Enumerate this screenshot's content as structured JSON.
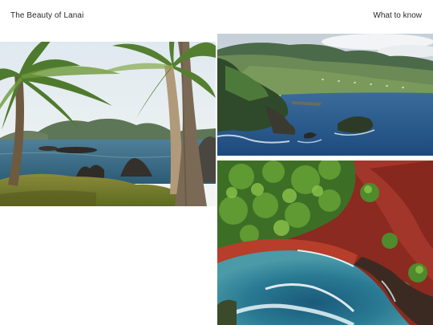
{
  "header": {
    "site_title": "The Beauty of Lanai",
    "nav_link": "What to know"
  },
  "gallery": {
    "images": [
      {
        "name": "palm-trees-beach-photo"
      },
      {
        "name": "coastal-cliffs-aerial-photo"
      },
      {
        "name": "red-sand-bay-aerial-photo"
      }
    ]
  },
  "colors": {
    "background": "#ffffff",
    "text": "#2a2a2a",
    "ocean": "#1f5a8a",
    "sand_red": "#9b2f22",
    "foliage": "#3f7a2a"
  }
}
